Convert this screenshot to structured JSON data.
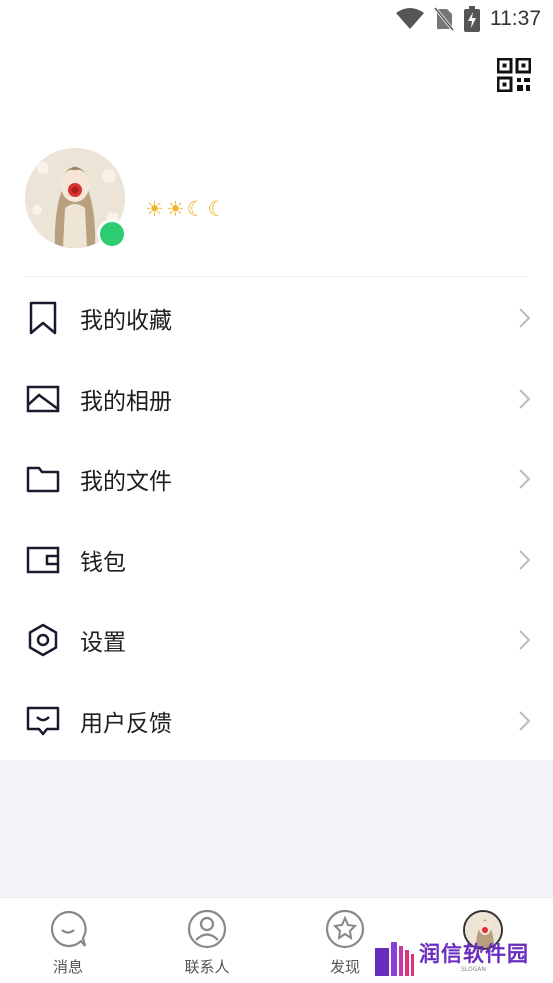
{
  "status_bar": {
    "time": "11:37",
    "icons": [
      "wifi-icon",
      "no-sim-icon",
      "battery-charging-icon"
    ]
  },
  "header": {
    "qr_icon": "qr-code-icon"
  },
  "profile": {
    "avatar": "user-avatar",
    "online_status_color": "#2ecc71",
    "level_icons": [
      "sun",
      "sun",
      "moon",
      "moon"
    ]
  },
  "menu": {
    "items": [
      {
        "label": "我的收藏",
        "icon": "bookmark-icon"
      },
      {
        "label": "我的相册",
        "icon": "image-icon"
      },
      {
        "label": "我的文件",
        "icon": "folder-icon"
      },
      {
        "label": "钱包",
        "icon": "wallet-icon"
      },
      {
        "label": "设置",
        "icon": "settings-hexagon-icon"
      },
      {
        "label": "用户反馈",
        "icon": "feedback-icon"
      }
    ]
  },
  "bottom_nav": {
    "items": [
      {
        "label": "消息",
        "icon": "message-icon"
      },
      {
        "label": "联系人",
        "icon": "contacts-icon"
      },
      {
        "label": "发现",
        "icon": "discover-icon"
      },
      {
        "label": "",
        "icon": "profile-avatar"
      }
    ]
  },
  "watermark": {
    "text": "润信软件园",
    "sub": "SLOGAN"
  },
  "colors": {
    "accent_online": "#2ecc71",
    "gray_background": "#f3f4f8",
    "watermark_purple": "#6a2cc0"
  }
}
